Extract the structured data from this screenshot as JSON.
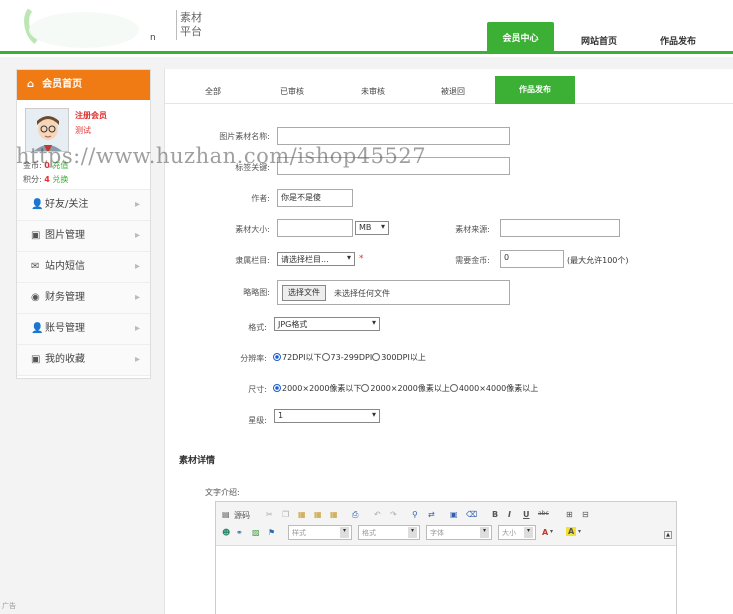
{
  "header": {
    "logo_text_line1": "素材",
    "logo_text_line2": "平台",
    "logo_tail": "n",
    "nav_active": "会员中心",
    "nav_home": "网站首页",
    "nav_publish": "作品发布",
    "accent_color": "#3cb035"
  },
  "sidebar": {
    "title": "会员首页",
    "user_role": "注册会员",
    "user_name": "测试",
    "gold_label": "金币:",
    "gold_value": "0",
    "gold_link": "充值",
    "points_label": "积分:",
    "points_value": "4",
    "points_link": "兑换",
    "items": [
      {
        "label": "好友/关注",
        "icon": "user-plus-icon"
      },
      {
        "label": "图片管理",
        "icon": "image-icon"
      },
      {
        "label": "站内短信",
        "icon": "mail-icon"
      },
      {
        "label": "财务管理",
        "icon": "money-bag-icon"
      },
      {
        "label": "账号管理",
        "icon": "account-icon"
      },
      {
        "label": "我的收藏",
        "icon": "favorite-icon"
      }
    ]
  },
  "tabs": {
    "all": "全部",
    "approved": "已审核",
    "pending": "未审核",
    "rejected": "被退回",
    "publish": "作品发布"
  },
  "form": {
    "name_label": "图片素材名称:",
    "name_value": "",
    "keywords_label": "标签关键:",
    "keywords_value": "",
    "author_label": "作者:",
    "author_value": "你是不是傻",
    "size_label": "素材大小:",
    "size_value": "",
    "size_unit": "MB",
    "source_label": "素材来源:",
    "source_value": "",
    "category_label": "隶属栏目:",
    "category_value": "请选择栏目...",
    "category_required": "*",
    "gold_required_label": "需要金币:",
    "gold_required_value": "0",
    "gold_required_note": "(最大允许100个)",
    "thumb_label": "略略图:",
    "file_button": "选择文件",
    "file_status": "未选择任何文件",
    "format_label": "格式:",
    "format_value": "JPG格式",
    "resolution_label": "分辨率:",
    "resolution_options": [
      "72DPI以下",
      "73-299DPI",
      "300DPI以上"
    ],
    "dimension_label": "尺寸:",
    "dimension_options": [
      "2000×2000像素以下",
      "2000×2000像素以上",
      "4000×4000像素以上"
    ],
    "level_label": "星级:",
    "level_value": "1",
    "detail_title": "素材详情",
    "intro_label": "文字介绍:"
  },
  "editor": {
    "source_label": "源码",
    "bold": "B",
    "italic": "I",
    "underline": "U",
    "strike": "abc",
    "style_placeholder": "样式",
    "format_placeholder": "格式",
    "font_placeholder": "字体",
    "size_placeholder": "大小",
    "font_color": "A",
    "bg_color": "A"
  },
  "watermark": "https://www.huzhan.com/ishop45527",
  "ad_label": "广告"
}
